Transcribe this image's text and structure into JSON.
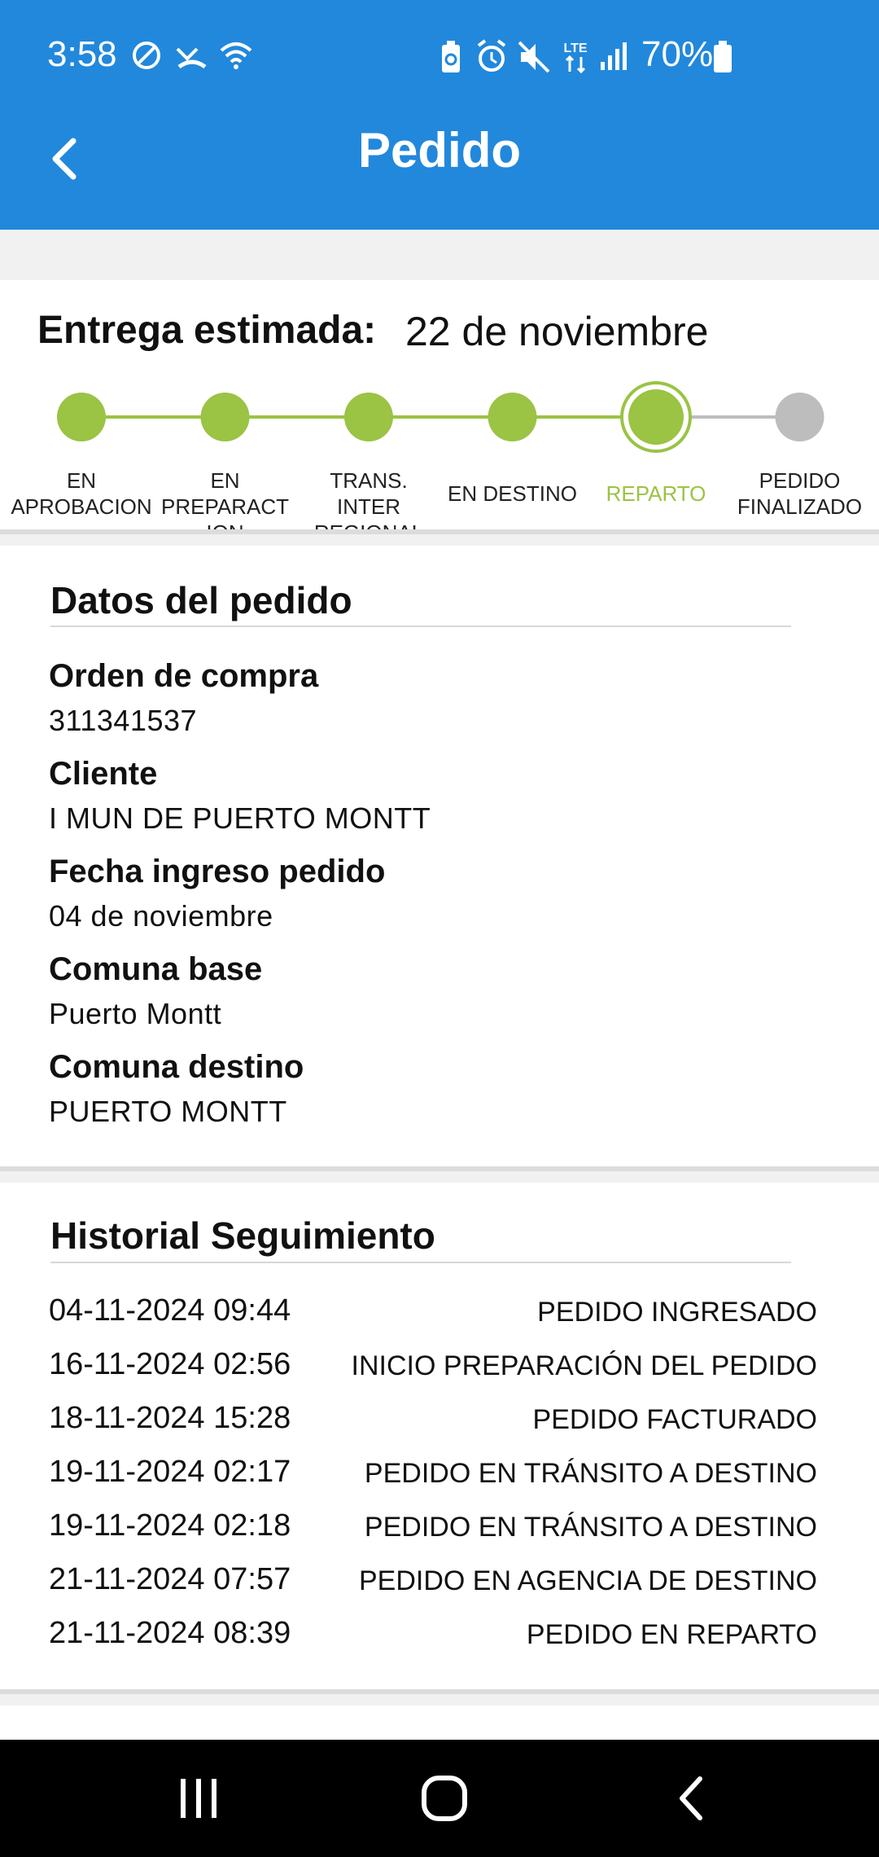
{
  "status_bar": {
    "time": "3:58",
    "battery": "70%",
    "network": "LTE",
    "icons": [
      "dnd-icon",
      "missed-call-icon",
      "wifi-icon",
      "battery-saver-icon",
      "alarm-icon",
      "mute-icon",
      "lte-icon",
      "signal-icon",
      "battery-icon"
    ]
  },
  "header": {
    "title": "Pedido",
    "back_icon": "chevron-left-icon"
  },
  "estimate": {
    "label": "Entrega estimada:",
    "value": "22 de noviembre"
  },
  "progress": {
    "completed_color": "#9bc344",
    "pending_color": "#bdbdbd",
    "current_index": 4,
    "steps": [
      {
        "label": "EN APROBACION",
        "state": "done"
      },
      {
        "label": "EN PREPARACT ION",
        "state": "done"
      },
      {
        "label": "TRANS. INTER REGIONAL",
        "state": "done"
      },
      {
        "label": "EN DESTINO",
        "state": "done"
      },
      {
        "label": "REPARTO",
        "state": "current"
      },
      {
        "label": "PEDIDO FINALIZADO",
        "state": "pending"
      }
    ]
  },
  "order_data": {
    "title": "Datos del pedido",
    "fields": [
      {
        "label": "Orden de compra",
        "value": "311341537"
      },
      {
        "label": "Cliente",
        "value": "I MUN DE PUERTO MONTT"
      },
      {
        "label": "Fecha ingreso pedido",
        "value": "04 de noviembre"
      },
      {
        "label": "Comuna base",
        "value": "Puerto Montt"
      },
      {
        "label": "Comuna destino",
        "value": "PUERTO MONTT"
      }
    ]
  },
  "history": {
    "title": "Historial Seguimiento",
    "rows": [
      {
        "date": "04-11-2024 09:44",
        "event": "PEDIDO INGRESADO"
      },
      {
        "date": "16-11-2024 02:56",
        "event": "INICIO PREPARACIÓN DEL PEDIDO"
      },
      {
        "date": "18-11-2024 15:28",
        "event": "PEDIDO FACTURADO"
      },
      {
        "date": "19-11-2024 02:17",
        "event": "PEDIDO EN TRÁNSITO A DESTINO"
      },
      {
        "date": "19-11-2024 02:18",
        "event": "PEDIDO EN TRÁNSITO A DESTINO"
      },
      {
        "date": "21-11-2024 07:57",
        "event": "PEDIDO EN AGENCIA DE DESTINO"
      },
      {
        "date": "21-11-2024 08:39",
        "event": "PEDIDO EN REPARTO"
      }
    ]
  },
  "nav_bar": {
    "buttons": [
      "recent-apps-icon",
      "home-icon",
      "back-icon"
    ]
  },
  "colors": {
    "app_bar": "#2288dc",
    "accent_green": "#9bc344"
  }
}
